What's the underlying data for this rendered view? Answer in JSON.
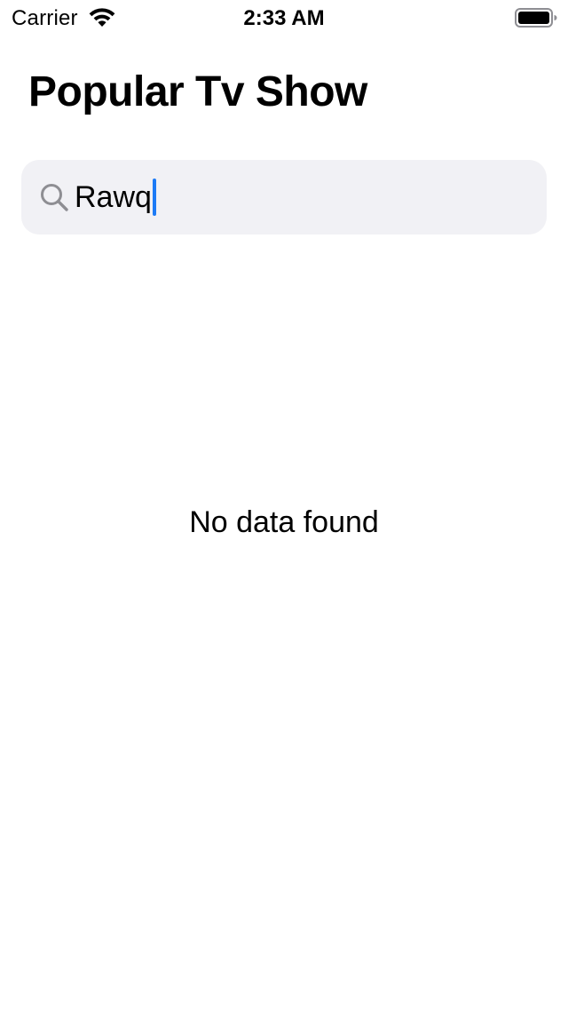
{
  "status_bar": {
    "carrier": "Carrier",
    "time": "2:33 AM",
    "wifi_icon": "wifi-icon",
    "battery_icon": "battery-icon"
  },
  "header": {
    "title": "Popular Tv Show"
  },
  "search": {
    "icon": "search-icon",
    "value": "Rawq"
  },
  "main": {
    "empty_message": "No data found"
  },
  "colors": {
    "search_background": "#f1f1f5",
    "cursor": "#1d7bf6",
    "icon_gray": "#8e8e93"
  }
}
